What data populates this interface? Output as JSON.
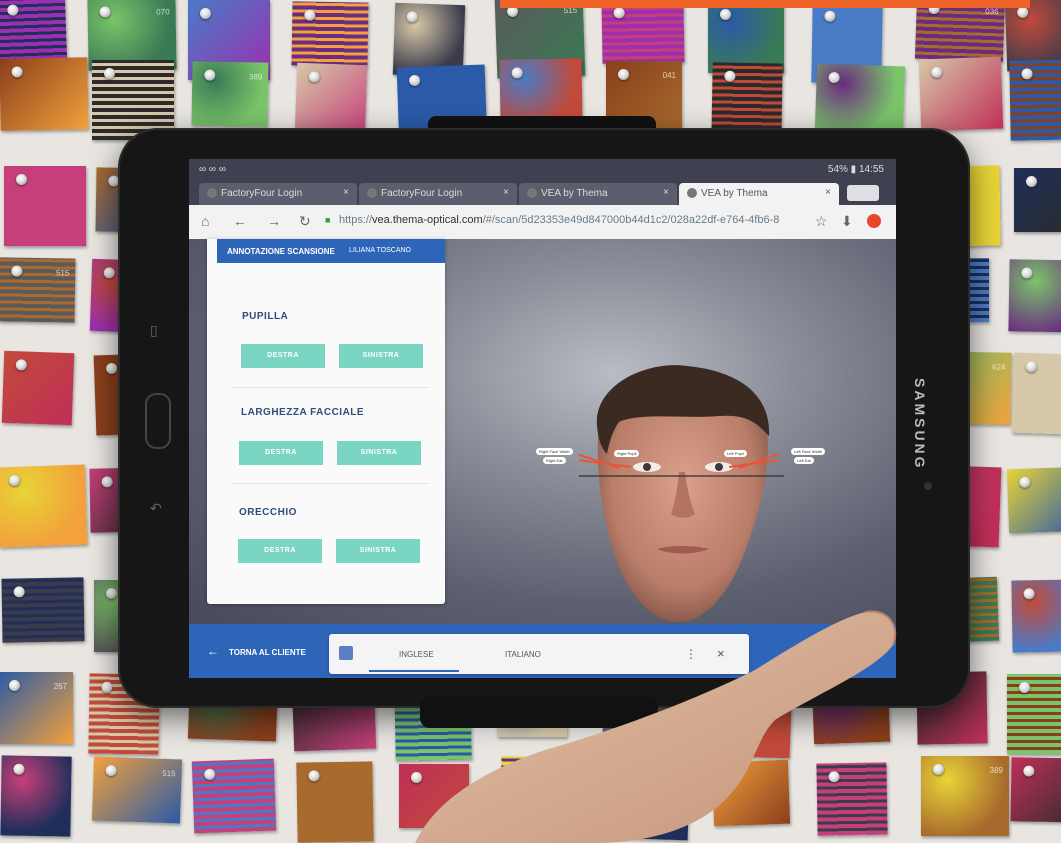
{
  "browser": {
    "status": {
      "left": "∞ ∞ ∞",
      "right": "54% ▮ 14:55"
    },
    "tabs": [
      {
        "label": "FactoryFour Login",
        "close": "×"
      },
      {
        "label": "FactoryFour Login",
        "close": "×"
      },
      {
        "label": "VEA by Thema",
        "close": "×"
      },
      {
        "label": "VEA by Thema",
        "close": "×"
      }
    ],
    "url_scheme": "https://",
    "url_host": "vea.thema-optical.com",
    "url_path": "/#/scan/5d23353e49d847000b44d1c2/028a22df-e764-4fb6-8"
  },
  "panel": {
    "title": "ANNOTAZIONE SCANSIONE",
    "patient": "LILIANA TOSCANO",
    "sections": [
      {
        "title": "PUPILLA",
        "right_label": "DESTRA",
        "left_label": "SINISTRA"
      },
      {
        "title": "LARGHEZZA FACCIALE",
        "right_label": "DESTRA",
        "left_label": "SINISTRA"
      },
      {
        "title": "ORECCHIO",
        "right_label": "DESTRA",
        "left_label": "SINISTRA"
      }
    ]
  },
  "face_labels": {
    "right_face_width": "Right Face Width",
    "right_pupil": "Right Pupil",
    "right_ear": "Right Ear",
    "left_pupil": "Left Pupil",
    "left_face_width": "Left Face Width",
    "left_ear": "Left Ear"
  },
  "footer": {
    "back_label": "TORNA AL CLIENTE",
    "translate_from": "INGLESE",
    "translate_to": "ITALIANO",
    "menu": "⋮",
    "close": "×"
  },
  "device_brand": "SAMSUNG",
  "colors": {
    "accent": "#2f65b9",
    "button": "#7bd5c3",
    "topbar": "#f0642a"
  },
  "swatch_numbers": [
    "267",
    "070",
    "036",
    "041",
    "624",
    "515",
    "389"
  ]
}
